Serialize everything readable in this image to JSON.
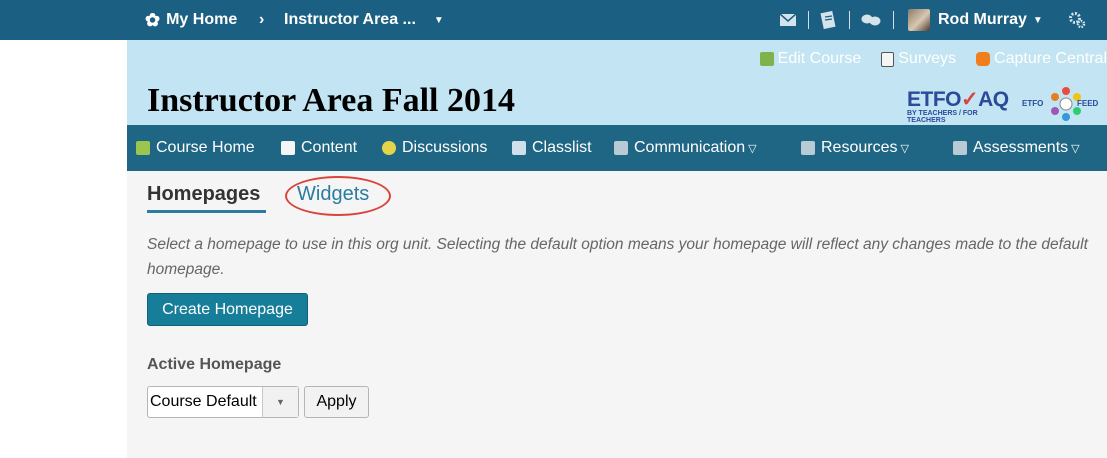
{
  "minibar": {
    "home_label": "My Home",
    "course_selector_label": "Instructor Area ...",
    "user_name": "Rod Murray"
  },
  "header": {
    "links": [
      {
        "label": "Edit Course",
        "icon": "pencil-icon"
      },
      {
        "label": "Surveys",
        "icon": "clipboard-icon"
      },
      {
        "label": "Capture Central",
        "icon": "capture-icon"
      }
    ],
    "course_title": "Instructor Area Fall 2014",
    "logo1_text": "ETFO",
    "logo1_suffix": "AQ",
    "logo1_tagline": "BY TEACHERS / FOR TEACHERS",
    "logo2_text": "ETFO",
    "logo2_suffix": "FEED"
  },
  "navbar": {
    "items": [
      {
        "label": "Course Home",
        "icon": "book-icon"
      },
      {
        "label": "Content",
        "icon": "open-book-icon"
      },
      {
        "label": "Discussions",
        "icon": "speech-bubbles-icon"
      },
      {
        "label": "Classlist",
        "icon": "grid-icon"
      },
      {
        "label": "Communication",
        "icon": "group-icon",
        "dropdown": true
      },
      {
        "label": "Resources",
        "icon": "group-icon",
        "dropdown": true
      },
      {
        "label": "Assessments",
        "icon": "group-icon",
        "dropdown": true
      }
    ]
  },
  "tabs": {
    "homepages": "Homepages",
    "widgets": "Widgets"
  },
  "description": "Select a homepage to use in this org unit. Selecting the default option means your homepage will reflect any changes made to the default homepage.",
  "create_button_label": "Create Homepage",
  "active_homepage": {
    "label": "Active Homepage",
    "selected_value": "Course Default",
    "apply_label": "Apply"
  },
  "colors": {
    "minibar_bg": "#1b5f82",
    "header_bg": "#c2e4f3",
    "navbar_bg": "#1e6683",
    "accent": "#2b7ca0",
    "primary_button": "#177e99",
    "highlight_oval": "#d9453d"
  }
}
